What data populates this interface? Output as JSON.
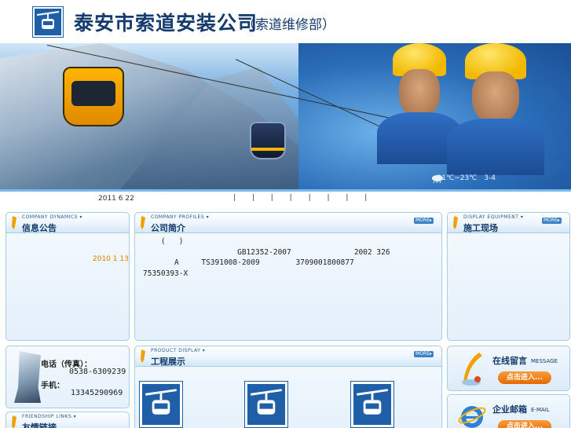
{
  "header": {
    "title": "泰安市索道安装公司",
    "subtitle": "（索道维修部）"
  },
  "banner": {
    "weather": "31℃~23℃　3-4"
  },
  "datebar": {
    "date": "2011 6 22",
    "separators": "| | | | | | | |"
  },
  "panels": {
    "notice": {
      "title_en": "COMPANY DYNAMICS ▾",
      "title_cn": "信息公告",
      "item_date": "2010 1 13"
    },
    "intro": {
      "title_en": "COMPANY PROFILES ▾",
      "title_cn": "公司简介",
      "more_label": "MORE",
      "lines": [
        "    (   )",
        "                     GB12352-2007              2002 326",
        "       A     TS391008-2009        3709001800877",
        "75350393-X"
      ]
    },
    "site": {
      "title_en": "DISPLAY EQUIPMENT ▾",
      "title_cn": "施工现场",
      "more_label": "MORE"
    },
    "contact": {
      "phone_label": "电话（传真）：",
      "phone_value": "0538-6309239",
      "mobile_label": "手机：",
      "mobile_value": "13345290969"
    },
    "products": {
      "title_en": "PRODUCT DISPLAY ▾",
      "title_cn": "工程展示",
      "more_label": "MORE"
    },
    "links": {
      "title_en": "FRIENDSHIP LINKS ▾",
      "title_cn": "友情链接"
    }
  },
  "side_cards": {
    "message": {
      "title": "在线留言",
      "en": "MESSAGE",
      "enter": "点击进入..."
    },
    "email": {
      "title": "企业邮箱",
      "en": "E-MAIL",
      "enter": "点击进入..."
    }
  },
  "colors": {
    "brand_blue": "#1f5fa8",
    "heading_navy": "#14396b",
    "accent_orange": "#e07b00"
  }
}
